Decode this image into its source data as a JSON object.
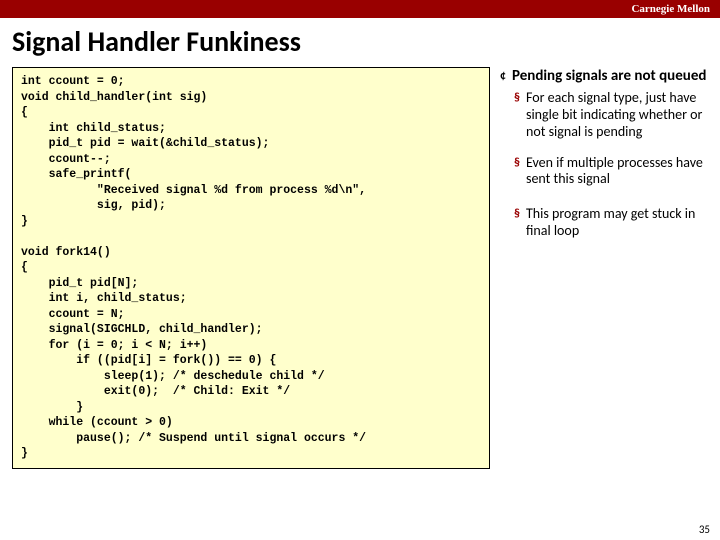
{
  "header": {
    "brand": "Carnegie Mellon"
  },
  "title": "Signal Handler Funkiness",
  "code": "int ccount = 0;\nvoid child_handler(int sig)\n{\n    int child_status;\n    pid_t pid = wait(&child_status);\n    ccount--;\n    safe_printf(\n           \"Received signal %d from process %d\\n\",\n           sig, pid);\n}\n\nvoid fork14()\n{\n    pid_t pid[N];\n    int i, child_status;\n    ccount = N;\n    signal(SIGCHLD, child_handler);\n    for (i = 0; i < N; i++)\n        if ((pid[i] = fork()) == 0) {\n            sleep(1); /* deschedule child */\n            exit(0);  /* Child: Exit */\n        }\n    while (ccount > 0)\n        pause(); /* Suspend until signal occurs */\n}",
  "bullets": {
    "b1": "Pending signals are not queued",
    "b1a": "For each signal type, just have single bit indicating whether or not signal is pending",
    "b1b": "Even if multiple processes have sent this signal",
    "b1c": "This program may get stuck in final loop"
  },
  "pagenum": "35"
}
